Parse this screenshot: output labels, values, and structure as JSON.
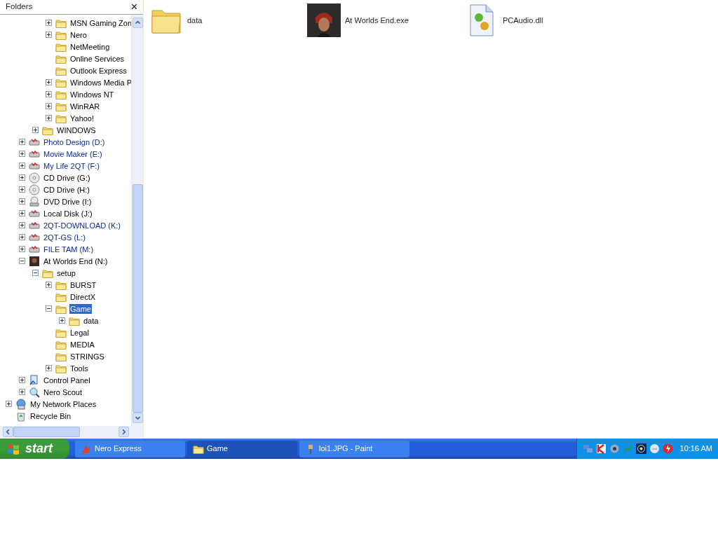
{
  "folders_pane": {
    "title": "Folders",
    "close": "×"
  },
  "tree": [
    {
      "children": [
        {
          "children": [
            {
              "children": [
                {
                  "label": "MSN Gaming Zon",
                  "kind": "folder",
                  "expanded": false,
                  "selected": false,
                  "compressed": false
                },
                {
                  "label": "Nero",
                  "kind": "folder",
                  "expanded": false,
                  "selected": false,
                  "compressed": false
                },
                {
                  "label": "NetMeeting",
                  "kind": "folder",
                  "selected": false,
                  "compressed": false
                },
                {
                  "label": "Online Services",
                  "kind": "folder",
                  "selected": false,
                  "compressed": false
                },
                {
                  "label": "Outlook Express",
                  "kind": "folder",
                  "selected": false,
                  "compressed": false
                },
                {
                  "label": "Windows Media P",
                  "kind": "folder",
                  "expanded": false,
                  "selected": false,
                  "compressed": false
                },
                {
                  "label": "Windows NT",
                  "kind": "folder",
                  "expanded": false,
                  "selected": false,
                  "compressed": false
                },
                {
                  "label": "WinRAR",
                  "kind": "folder",
                  "expanded": false,
                  "selected": false,
                  "compressed": false
                },
                {
                  "label": "Yahoo!",
                  "kind": "folder",
                  "expanded": false,
                  "selected": false,
                  "compressed": false
                }
              ]
            },
            {
              "label": "WINDOWS",
              "kind": "folder",
              "expanded": false,
              "selected": false,
              "compressed": false
            }
          ]
        },
        {
          "label": "Photo Design (D:)",
          "kind": "drive",
          "expanded": false,
          "selected": false,
          "compressed": true
        },
        {
          "label": "Movie Maker (E:)",
          "kind": "drive",
          "expanded": false,
          "selected": false,
          "compressed": true
        },
        {
          "label": "My Life 2QT (F:)",
          "kind": "drive",
          "expanded": false,
          "selected": false,
          "compressed": true
        },
        {
          "label": "CD Drive (G:)",
          "kind": "cd",
          "expanded": false,
          "selected": false,
          "compressed": false
        },
        {
          "label": "CD Drive (H:)",
          "kind": "cd",
          "expanded": false,
          "selected": false,
          "compressed": false
        },
        {
          "label": "DVD Drive (I:)",
          "kind": "dvd",
          "expanded": false,
          "selected": false,
          "compressed": false
        },
        {
          "label": "Local Disk (J:)",
          "kind": "drive",
          "expanded": false,
          "selected": false,
          "compressed": false
        },
        {
          "label": "2QT-DOWNLOAD (K:)",
          "kind": "drive",
          "expanded": false,
          "selected": false,
          "compressed": true
        },
        {
          "label": "2QT-GS (L:)",
          "kind": "drive",
          "expanded": false,
          "selected": false,
          "compressed": true
        },
        {
          "label": "FILE TAM (M:)",
          "kind": "drive",
          "expanded": false,
          "selected": false,
          "compressed": true
        },
        {
          "label": "At Worlds End (N:)",
          "kind": "picture",
          "expanded": true,
          "selected": false,
          "compressed": false,
          "children": [
            {
              "label": "setup",
              "kind": "folder",
              "expanded": true,
              "selected": false,
              "compressed": false,
              "children": [
                {
                  "label": "BURST",
                  "kind": "folder",
                  "expanded": false,
                  "selected": false,
                  "compressed": false
                },
                {
                  "label": "DirectX",
                  "kind": "folder",
                  "selected": false,
                  "compressed": false
                },
                {
                  "label": "Game",
                  "kind": "folder",
                  "expanded": true,
                  "selected": true,
                  "compressed": false,
                  "children": [
                    {
                      "label": "data",
                      "kind": "folder",
                      "expanded": false,
                      "selected": false,
                      "compressed": false
                    }
                  ]
                },
                {
                  "label": "Legal",
                  "kind": "folder",
                  "selected": false,
                  "compressed": false
                },
                {
                  "label": "MEDIA",
                  "kind": "folder",
                  "selected": false,
                  "compressed": false
                },
                {
                  "label": "STRINGS",
                  "kind": "folder",
                  "selected": false,
                  "compressed": false
                },
                {
                  "label": "Tools",
                  "kind": "folder",
                  "expanded": false,
                  "selected": false,
                  "compressed": false
                }
              ]
            }
          ]
        },
        {
          "label": "Control Panel",
          "kind": "control",
          "expanded": false,
          "selected": false,
          "compressed": false
        },
        {
          "label": "Nero Scout",
          "kind": "scout",
          "expanded": false,
          "selected": false,
          "compressed": false
        }
      ]
    },
    {
      "label": "My Network Places",
      "kind": "network",
      "expanded": false,
      "selected": false,
      "compressed": false
    },
    {
      "label": "Recycle Bin",
      "kind": "recycle",
      "selected": false,
      "compressed": false
    }
  ],
  "files": [
    {
      "name": "data",
      "kind": "folder"
    },
    {
      "name": "At Worlds End.exe",
      "kind": "picture"
    },
    {
      "name": "PCAudio.dll",
      "kind": "dll"
    }
  ],
  "taskbar": {
    "start": "start",
    "tasks": [
      {
        "label": "Nero Express",
        "kind": "nero",
        "selected": false
      },
      {
        "label": "Game",
        "kind": "folder",
        "selected": true
      },
      {
        "label": "loi1.JPG - Paint",
        "kind": "paint",
        "selected": false
      }
    ],
    "clock": "10:16 AM"
  }
}
